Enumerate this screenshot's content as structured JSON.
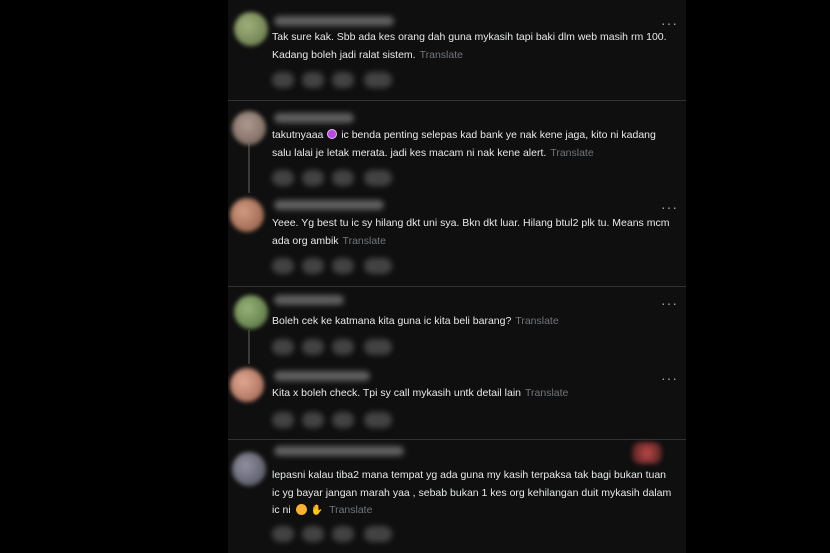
{
  "feed": {
    "translate_label": "Translate",
    "more_icon": "more-horizontal-icon",
    "comments": [
      {
        "id": "c1",
        "text": "Tak sure kak. Sbb ada kes orang dah guna mykasih tapi baki dlm web masih rm 100. Kadang boleh jadi ralat sistem.",
        "avatar_color": "#7d8f5e"
      },
      {
        "id": "c2",
        "text_before": "takutnyaaa",
        "emoji": "purple-circle-emoji",
        "text_after": "ic benda penting selepas kad bank ye nak kene jaga, kito ni kadang salu lalai je letak merata. jadi kes macam ni nak kene alert.",
        "avatar_color": "#8a7a72"
      },
      {
        "id": "c3",
        "text": "Yeee. Yg best tu ic sy hilang dkt uni sya. Bkn dkt luar. Hilang btul2 plk tu. Means mcm ada org ambik",
        "avatar_color": "#a2705a"
      },
      {
        "id": "c4",
        "text": "Boleh cek ke katmana kita guna ic kita beli barang?",
        "avatar_color": "#6d8a52"
      },
      {
        "id": "c5",
        "text": "Kita x boleh check. Tpi sy call mykasih untk detail lain",
        "avatar_color": "#b07862"
      },
      {
        "id": "c6",
        "text": "lepasni kalau tiba2 mana tempat yg ada guna my kasih terpaksa tak bagi bukan tuan ic yg bayar jangan marah yaa , sebab bukan 1 kes org kehilangan duit mykasih dalam ic ni",
        "emojis": [
          "pensive-face-emoji",
          "folded-hands-emoji"
        ],
        "avatar_color": "#6e6e78"
      }
    ]
  },
  "colors": {
    "background": "#000000",
    "panel": "#0f0f0f",
    "text": "#e7e9ea",
    "muted": "#71767b",
    "divider": "#2f3336"
  }
}
